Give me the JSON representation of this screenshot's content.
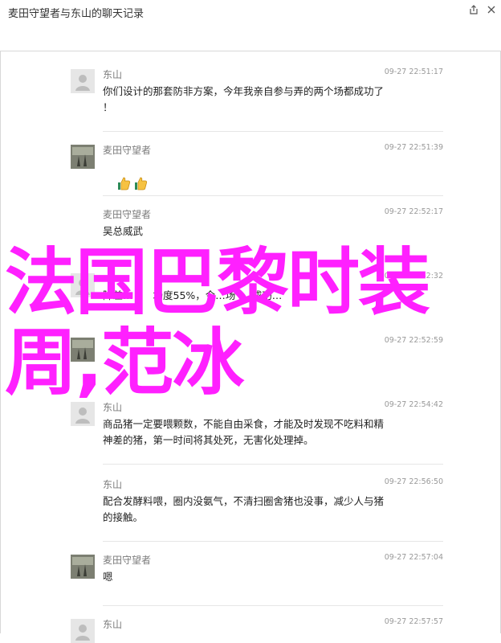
{
  "window": {
    "title": "麦田守望者与东山的聊天记录"
  },
  "messages": [
    {
      "sender": "东山",
      "time": "09-27 22:51:17",
      "text": "你们设计的那套防非方案，今年我亲自参与弄的两个场都成功了\n！",
      "avatar": "default-avatar"
    },
    {
      "sender": "麦田守望者",
      "time": "09-27 22:51:39",
      "text": "",
      "emoji": [
        "thumbs-up-icon",
        "thumbs-up-icon"
      ],
      "avatar": "photo-avatar"
    },
    {
      "sender": "麦田守望者",
      "time": "09-27 22:52:17",
      "text": "吴总威武",
      "avatar": "none"
    },
    {
      "sender": "东山",
      "time": "09-27 22:52:32",
      "text": "",
      "avatar": "default-avatar"
    },
    {
      "sender": "麦田守望者",
      "time": "09-27 22:52:59",
      "text": "",
      "avatar": "photo-avatar"
    },
    {
      "sender": "东山",
      "time": "09-27 22:54:42",
      "text": "商品猪一定要喂颗数，不能自由采食，才能及时发现不吃料和精\n神差的猪，第一时间将其处死，无害化处理掉。",
      "avatar": "default-avatar"
    },
    {
      "sender": "东山",
      "time": "09-27 22:56:50",
      "text": "配合发酵料喂，圈内没氨气，不清扫圈舍猪也没事，减少人与猪\n的接触。",
      "avatar": "none"
    },
    {
      "sender": "麦田守望者",
      "time": "09-27 22:57:04",
      "text": "嗯",
      "avatar": "photo-avatar"
    },
    {
      "sender": "东山",
      "time": "09-27 22:57:57",
      "text": "",
      "avatar": "default-avatar"
    }
  ],
  "partial_text": {
    "msg4_visible": "降差…　　场度55%，今…场  　成功…"
  },
  "overlay": {
    "text": "法国巴黎时装\n周,范冰"
  },
  "colors": {
    "overlay": "#ff20ff",
    "sender": "#7a7a7a",
    "time": "#999999"
  }
}
